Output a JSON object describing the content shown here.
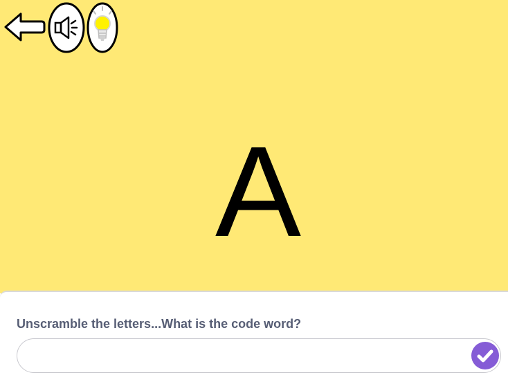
{
  "stage": {
    "background_color": "#FFE975",
    "letter": "A"
  },
  "toolbar": {
    "back_icon": "back-arrow-icon",
    "speaker_icon": "speaker-icon",
    "hint_icon": "lightbulb-icon"
  },
  "question": {
    "prompt": "Unscramble the letters...What is the code word?",
    "answer_value": "",
    "submit_icon": "checkmark-icon",
    "accent_color": "#855CD6",
    "text_color": "#575E75"
  }
}
